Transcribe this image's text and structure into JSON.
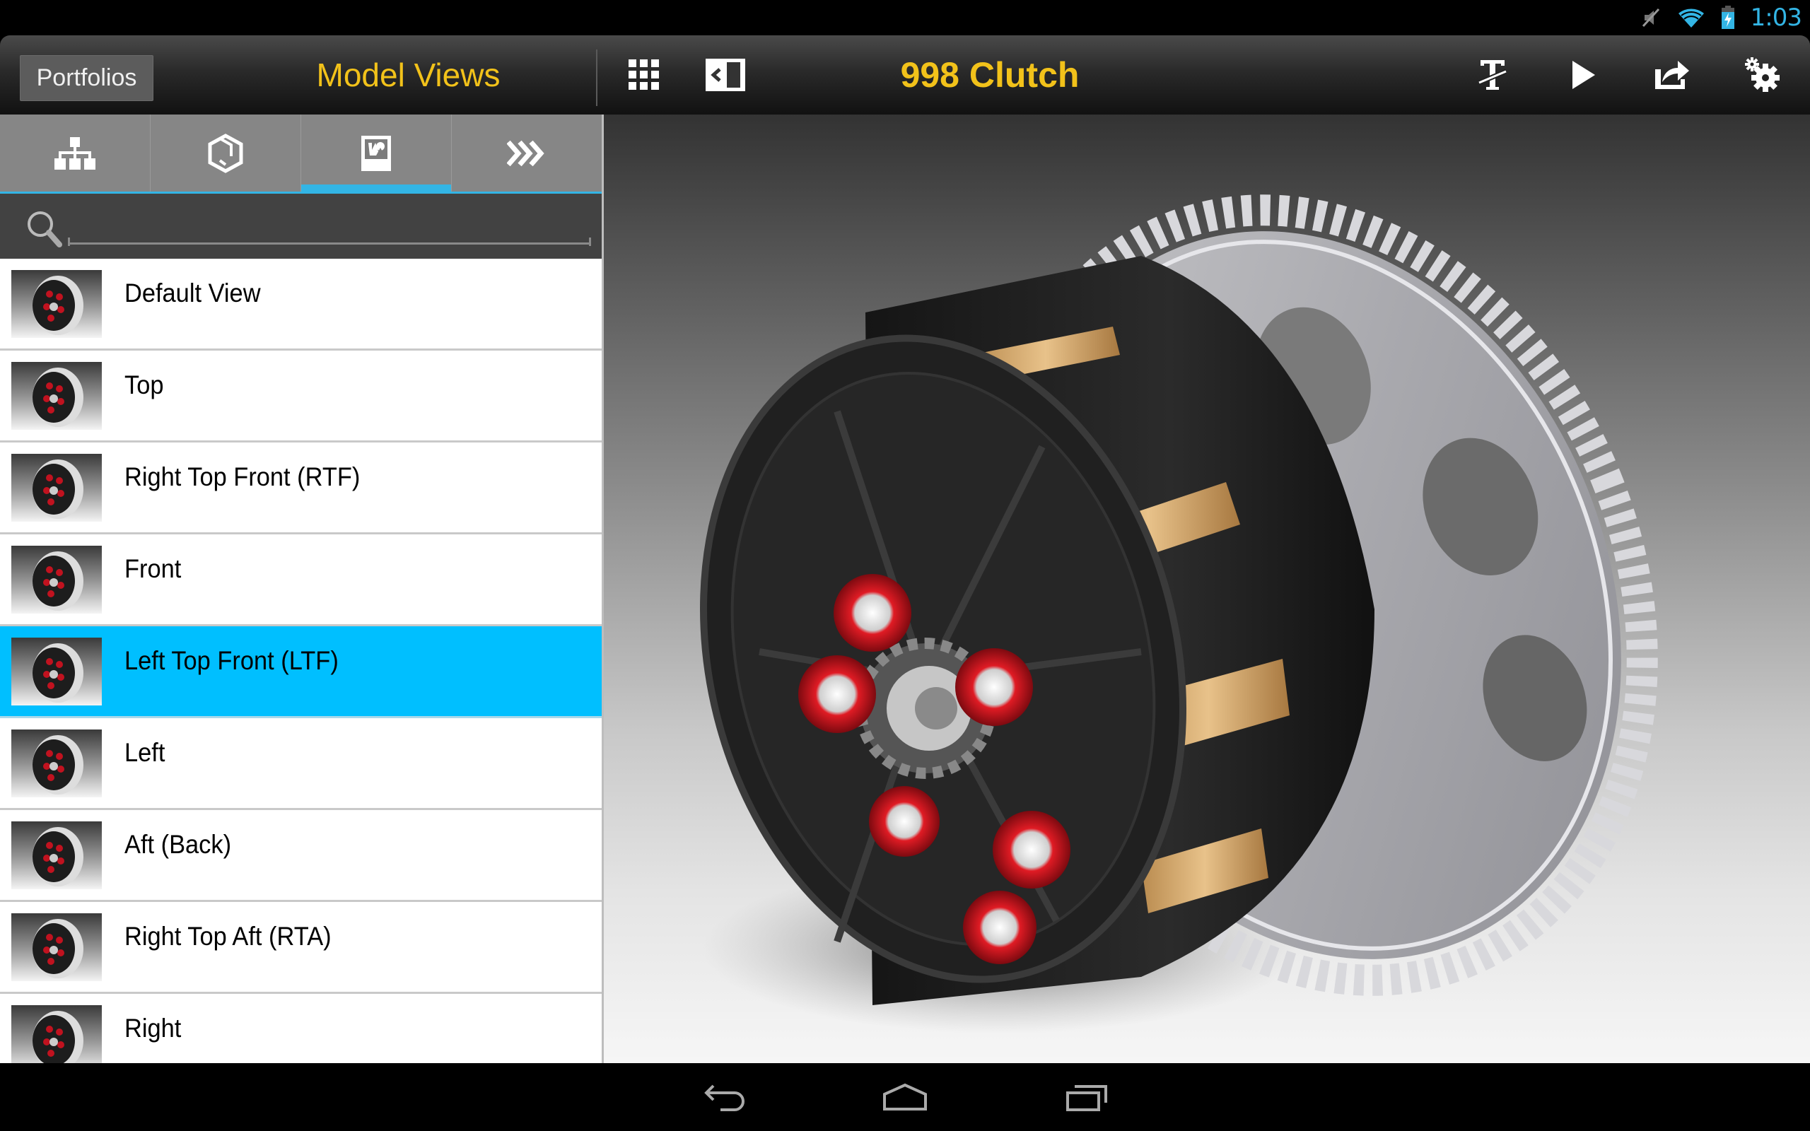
{
  "status_bar": {
    "time": "1:03",
    "icons": [
      "mute-icon",
      "wifi-icon",
      "battery-charging-icon"
    ]
  },
  "header": {
    "portfolios_label": "Portfolios",
    "panel_title": "Model Views",
    "model_title": "998 Clutch",
    "left_icons": [
      "grid-icon",
      "collapse-panel-icon"
    ],
    "right_icons": [
      "text-strike-icon",
      "play-icon",
      "share-icon",
      "settings-icon"
    ]
  },
  "tabs": [
    {
      "name": "hierarchy-icon",
      "active": false
    },
    {
      "name": "model-icon",
      "active": false
    },
    {
      "name": "views-icon",
      "active": true
    },
    {
      "name": "more-icon",
      "active": false
    }
  ],
  "search": {
    "value": "",
    "placeholder": ""
  },
  "views": [
    {
      "label": "Default View",
      "selected": false
    },
    {
      "label": "Top",
      "selected": false
    },
    {
      "label": "Right Top Front (RTF)",
      "selected": false
    },
    {
      "label": "Front",
      "selected": false
    },
    {
      "label": "Left Top Front (LTF)",
      "selected": true
    },
    {
      "label": "Left",
      "selected": false
    },
    {
      "label": "Aft (Back)",
      "selected": false
    },
    {
      "label": "Right Top Aft (RTA)",
      "selected": false
    },
    {
      "label": "Right",
      "selected": false
    }
  ],
  "colors": {
    "accent": "#33b5e5",
    "title_yellow": "#f2c21a",
    "selected_row": "#00bfff"
  },
  "navbar": {
    "icons": [
      "back-icon",
      "home-icon",
      "recents-icon"
    ]
  }
}
